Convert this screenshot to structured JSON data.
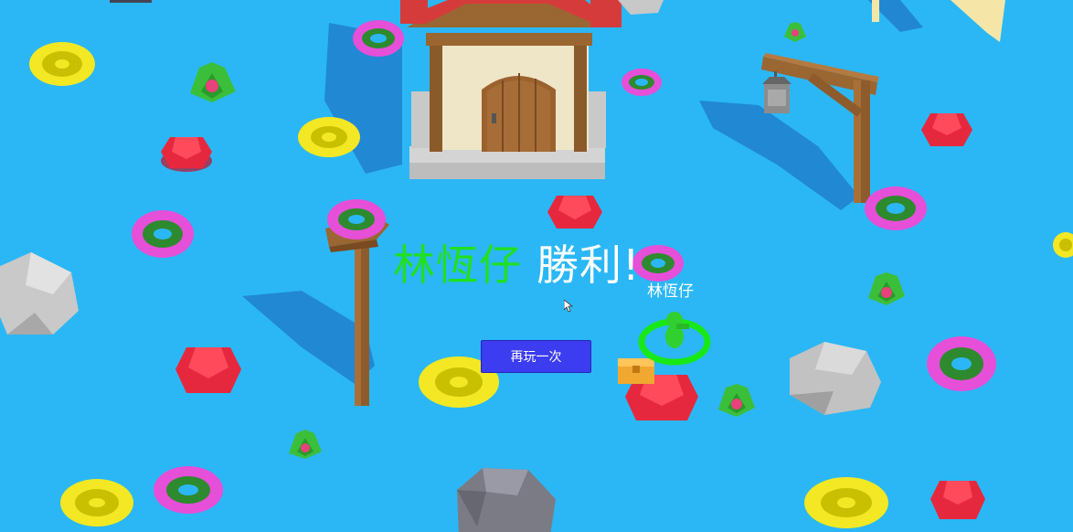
{
  "result": {
    "winner_name": "林恆仔",
    "win_text": "勝利!"
  },
  "player": {
    "name_tag": "林恆仔"
  },
  "actions": {
    "replay_label": "再玩一次"
  },
  "colors": {
    "water": "#2bb7f5",
    "winner_text": "#20e020",
    "button": "#3c3cf0",
    "player_ring": "#18e818"
  },
  "icons": {
    "cursor": "mouse-pointer-icon"
  }
}
